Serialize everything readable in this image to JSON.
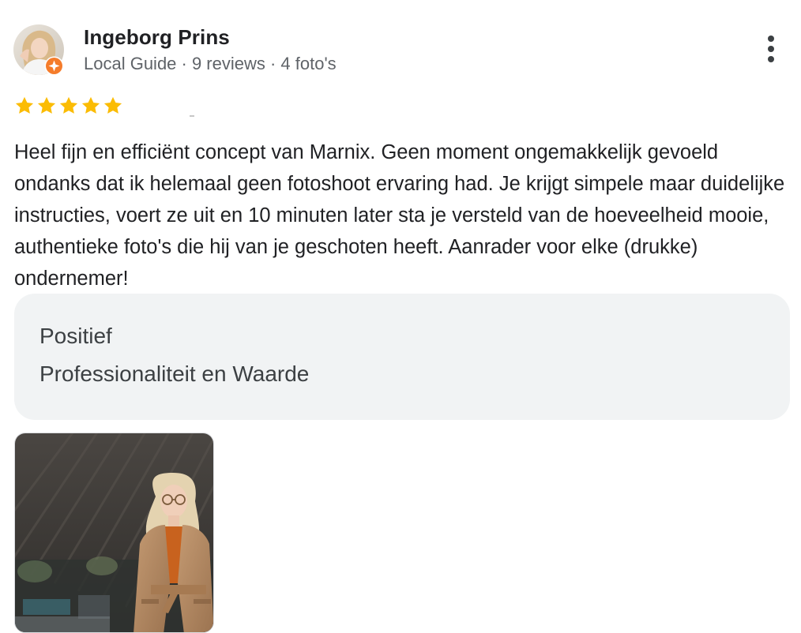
{
  "reviewer": {
    "name": "Ingeborg Prins",
    "meta": "Local Guide · 9 reviews · 4 foto's"
  },
  "rating": {
    "stars": 5,
    "max": 5,
    "star_color": "#fbbc04"
  },
  "review": {
    "text": "Heel fijn en efficiënt concept van Marnix. Geen moment ongemakkelijk gevoeld ondanks dat ik helemaal geen fotoshoot ervaring had. Je krijgt simpele maar duidelijke instructies, voert ze uit en 10 minuten later sta je versteld van de hoeveelheid mooie, authentieke foto's die hij van je geschoten heeft. Aanrader voor elke (drukke) ondernemer!"
  },
  "highlight": {
    "title": "Positief",
    "value": "Professionaliteit en Waarde"
  },
  "icons": {
    "avatar": "avatar",
    "badge": "local-guide-badge-icon",
    "menu": "more-vertical-icon",
    "star": "star-icon"
  },
  "colors": {
    "badge": "#f57c2b",
    "meta_text": "#5f6368",
    "highlight_bg": "#f1f3f4"
  }
}
